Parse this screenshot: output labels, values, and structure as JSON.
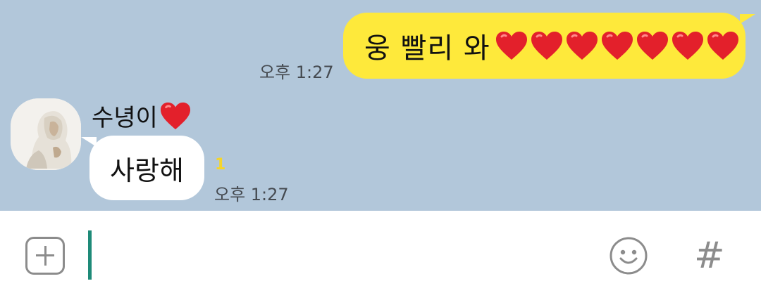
{
  "chat": {
    "background_color": "#b2c7da",
    "outgoing": {
      "text": "웅 빨리 와",
      "heart_count": 7,
      "time": "오후 1:27",
      "bubble_color": "#fee93b"
    },
    "incoming": {
      "sender": "수녕이",
      "text": "사랑해",
      "unread_count": "1",
      "time": "오후 1:27"
    }
  },
  "input_bar": {
    "attach_icon": "plus-box-icon",
    "message_value": "",
    "emoji_icon": "smiley-icon",
    "hashtag_icon": "#",
    "cursor_color": "#1e8a78"
  }
}
